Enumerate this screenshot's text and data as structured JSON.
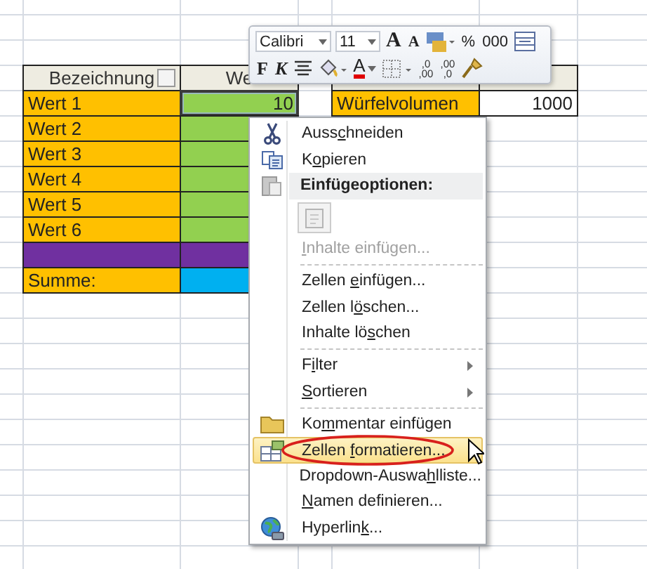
{
  "sheet": {
    "rows": [
      {
        "cells": [
          {
            "kind": "header-filter",
            "text": "Bezeichnung",
            "selected": false
          },
          {
            "kind": "header",
            "text": "We",
            "selected": false
          },
          {
            "kind": "header",
            "selected": false
          },
          {
            "kind": "header",
            "selected": false
          }
        ]
      },
      {
        "cells": [
          {
            "text": "Wert 1",
            "color": "#ffc000",
            "selected": false
          },
          {
            "kind": "number",
            "text": "10",
            "color": "#92d050",
            "selected": true
          },
          {
            "text": "Würfelvolumen",
            "color": "#ffc000",
            "selected": false
          },
          {
            "kind": "number",
            "text": "1000",
            "selected": false
          }
        ]
      },
      {
        "cells": [
          {
            "text": "Wert 2",
            "color": "#ffc000",
            "selected": false
          },
          {
            "color": "#92d050",
            "selected": false
          }
        ]
      },
      {
        "cells": [
          {
            "text": "Wert 3",
            "color": "#ffc000",
            "selected": false
          },
          {
            "color": "#92d050",
            "selected": false
          }
        ]
      },
      {
        "cells": [
          {
            "text": "Wert 4",
            "color": "#ffc000",
            "selected": false
          },
          {
            "color": "#92d050",
            "selected": false
          }
        ]
      },
      {
        "cells": [
          {
            "text": "Wert 5",
            "color": "#ffc000",
            "selected": false
          },
          {
            "color": "#92d050",
            "selected": false
          }
        ]
      },
      {
        "cells": [
          {
            "text": "Wert 6",
            "color": "#ffc000",
            "selected": false
          },
          {
            "color": "#92d050",
            "selected": false
          }
        ]
      },
      {
        "cells": [
          {
            "color": "#7030a0",
            "selected": false
          },
          {
            "color": "#7030a0",
            "selected": false
          }
        ]
      },
      {
        "cells": [
          {
            "text": "Summe:",
            "color": "#ffc000",
            "selected": false
          },
          {
            "color": "#00b0f0",
            "selected": false
          }
        ]
      }
    ]
  },
  "mini_toolbar": {
    "font": "Calibri",
    "size": "11",
    "row_1": [
      {
        "kind": "grow",
        "label": "A"
      },
      {
        "kind": "shrink",
        "label": "A"
      },
      {
        "kind": "styles"
      },
      {
        "kind": "text",
        "label": "%"
      },
      {
        "kind": "text",
        "label": "000"
      },
      {
        "kind": "merge"
      }
    ],
    "row_2": [
      {
        "kind": "bold",
        "label": "F"
      },
      {
        "kind": "italic",
        "label": "K"
      },
      {
        "kind": "center"
      },
      {
        "kind": "fill"
      },
      {
        "kind": "font-color",
        "label": "A"
      },
      {
        "kind": "borders"
      },
      {
        "kind": "decimal",
        "top": ",0",
        "bottom": ",00"
      },
      {
        "kind": "decimal",
        "top": ",00",
        "bottom": ",0"
      },
      {
        "kind": "painter"
      }
    ]
  },
  "context_menu": {
    "items": [
      {
        "kind": "item",
        "label": {
          "before": "Auss",
          "key": "c",
          "after": "hneiden"
        },
        "disabled": false,
        "selected": false
      },
      {
        "kind": "item",
        "label": {
          "before": "K",
          "key": "o",
          "after": "pieren"
        },
        "disabled": false,
        "selected": false
      },
      {
        "kind": "heading",
        "label": {
          "after": "Einfügeoptionen:"
        }
      },
      {
        "kind": "paste-option"
      },
      {
        "kind": "item",
        "label": {
          "key": "I",
          "after": "nhalte einfügen..."
        },
        "disabled": true,
        "selected": false,
        "separator_after": true
      },
      {
        "kind": "item",
        "label": {
          "before": "Zellen ",
          "key": "e",
          "after": "infügen..."
        },
        "disabled": false,
        "selected": false
      },
      {
        "kind": "item",
        "label": {
          "before": "Zellen l",
          "key": "ö",
          "after": "schen..."
        },
        "disabled": false,
        "selected": false
      },
      {
        "kind": "item",
        "label": {
          "before": "Inhalte lö",
          "key": "s",
          "after": "chen"
        },
        "disabled": false,
        "selected": false,
        "separator_after": true
      },
      {
        "kind": "item",
        "label": {
          "before": "F",
          "key": "i",
          "after": "lter"
        },
        "disabled": false,
        "selected": false,
        "submenu": true
      },
      {
        "kind": "item",
        "label": {
          "key": "S",
          "after": "ortieren"
        },
        "disabled": false,
        "selected": false,
        "submenu": true,
        "separator_after": true
      },
      {
        "kind": "item",
        "label": {
          "before": "Ko",
          "key": "m",
          "after": "mentar einfügen"
        },
        "disabled": false,
        "selected": false
      },
      {
        "kind": "item",
        "label": {
          "before": "Zellen ",
          "key": "f",
          "after": "ormatieren..."
        },
        "disabled": false,
        "selected": true,
        "circled": true
      },
      {
        "kind": "item",
        "label": {
          "before": "Dropdown-Auswa",
          "key": "h",
          "after": "lliste..."
        },
        "disabled": false,
        "selected": false
      },
      {
        "kind": "item",
        "label": {
          "key": "N",
          "after": "amen definieren..."
        },
        "disabled": false,
        "selected": false
      },
      {
        "kind": "item",
        "label": {
          "before": "Hyperlin",
          "key": "k",
          "after": "..."
        },
        "disabled": false,
        "selected": false
      }
    ]
  }
}
